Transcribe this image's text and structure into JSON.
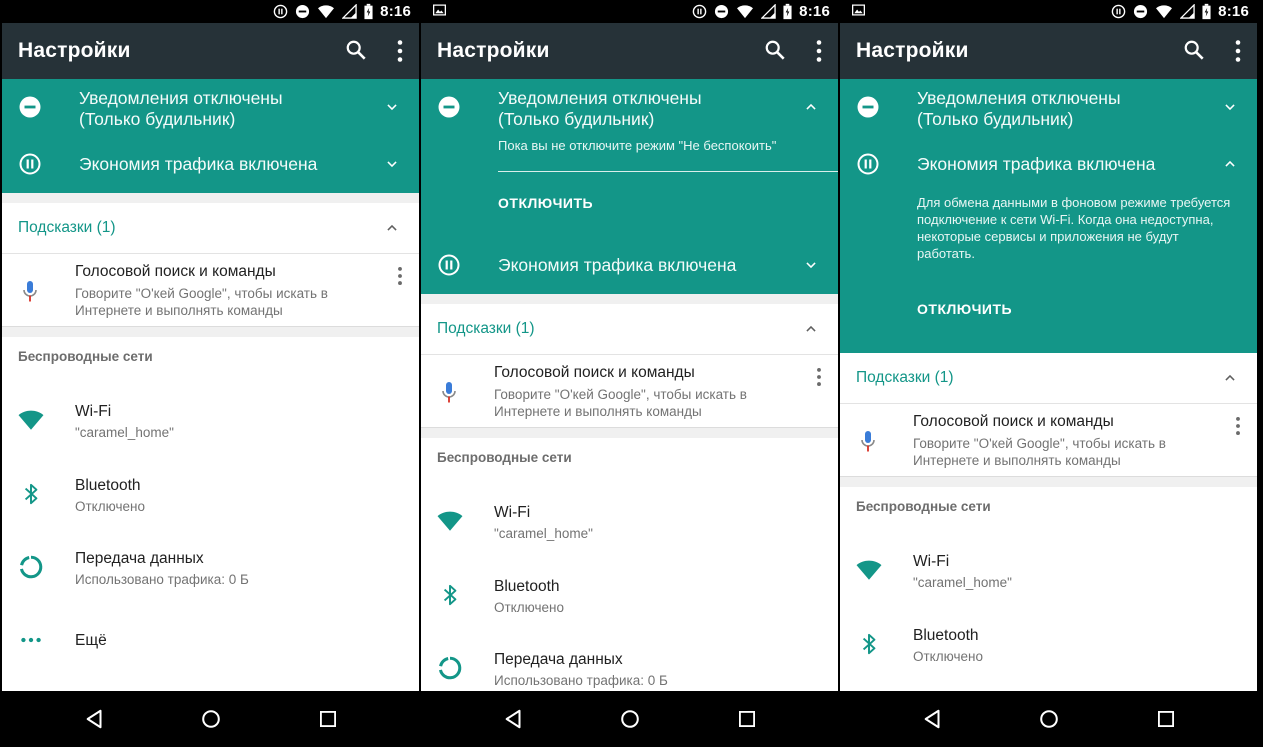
{
  "status": {
    "time": "8:16"
  },
  "appbar": {
    "title": "Настройки"
  },
  "conditions": {
    "dnd": {
      "title_line1": "Уведомления отключены",
      "title_line2": "(Только будильник)",
      "summary": "Пока вы не отключите режим \"Не беспокоить\"",
      "action": "ОТКЛЮЧИТЬ"
    },
    "datasaver": {
      "title": "Экономия трафика включена",
      "summary": "Для обмена данными в фоновом режиме требуется подключение к сети Wi-Fi. Когда она недоступна, некоторые сервисы и приложения не будут работать.",
      "action": "ОТКЛЮЧИТЬ"
    }
  },
  "suggestions": {
    "header": "Подсказки (1)",
    "item": {
      "title": "Голосовой поиск и команды",
      "subtitle_line1": "Говорите \"О'кей Google\", чтобы искать в",
      "subtitle_line2": "Интернете и выполнять команды"
    }
  },
  "wireless": {
    "category": "Беспроводные сети",
    "wifi": {
      "title": "Wi-Fi",
      "summary": "\"caramel_home\""
    },
    "bluetooth": {
      "title": "Bluetooth",
      "summary": "Отключено"
    },
    "data": {
      "title": "Передача данных",
      "summary": "Использовано трафика: 0 Б"
    },
    "more": {
      "title": "Ещё"
    }
  },
  "icons": {
    "condition_dnd": "minus-circle-icon",
    "condition_datasaver": "pause-circle-icon",
    "wifi": "wifi-icon",
    "bluetooth": "bluetooth-icon",
    "data": "data-usage-icon",
    "more": "more-horiz-icon",
    "mic": "mic-icon"
  },
  "colors": {
    "accent": "#139688",
    "appbar": "#263238",
    "mic_blue": "#3a7cd8",
    "mic_red": "#d93025"
  }
}
